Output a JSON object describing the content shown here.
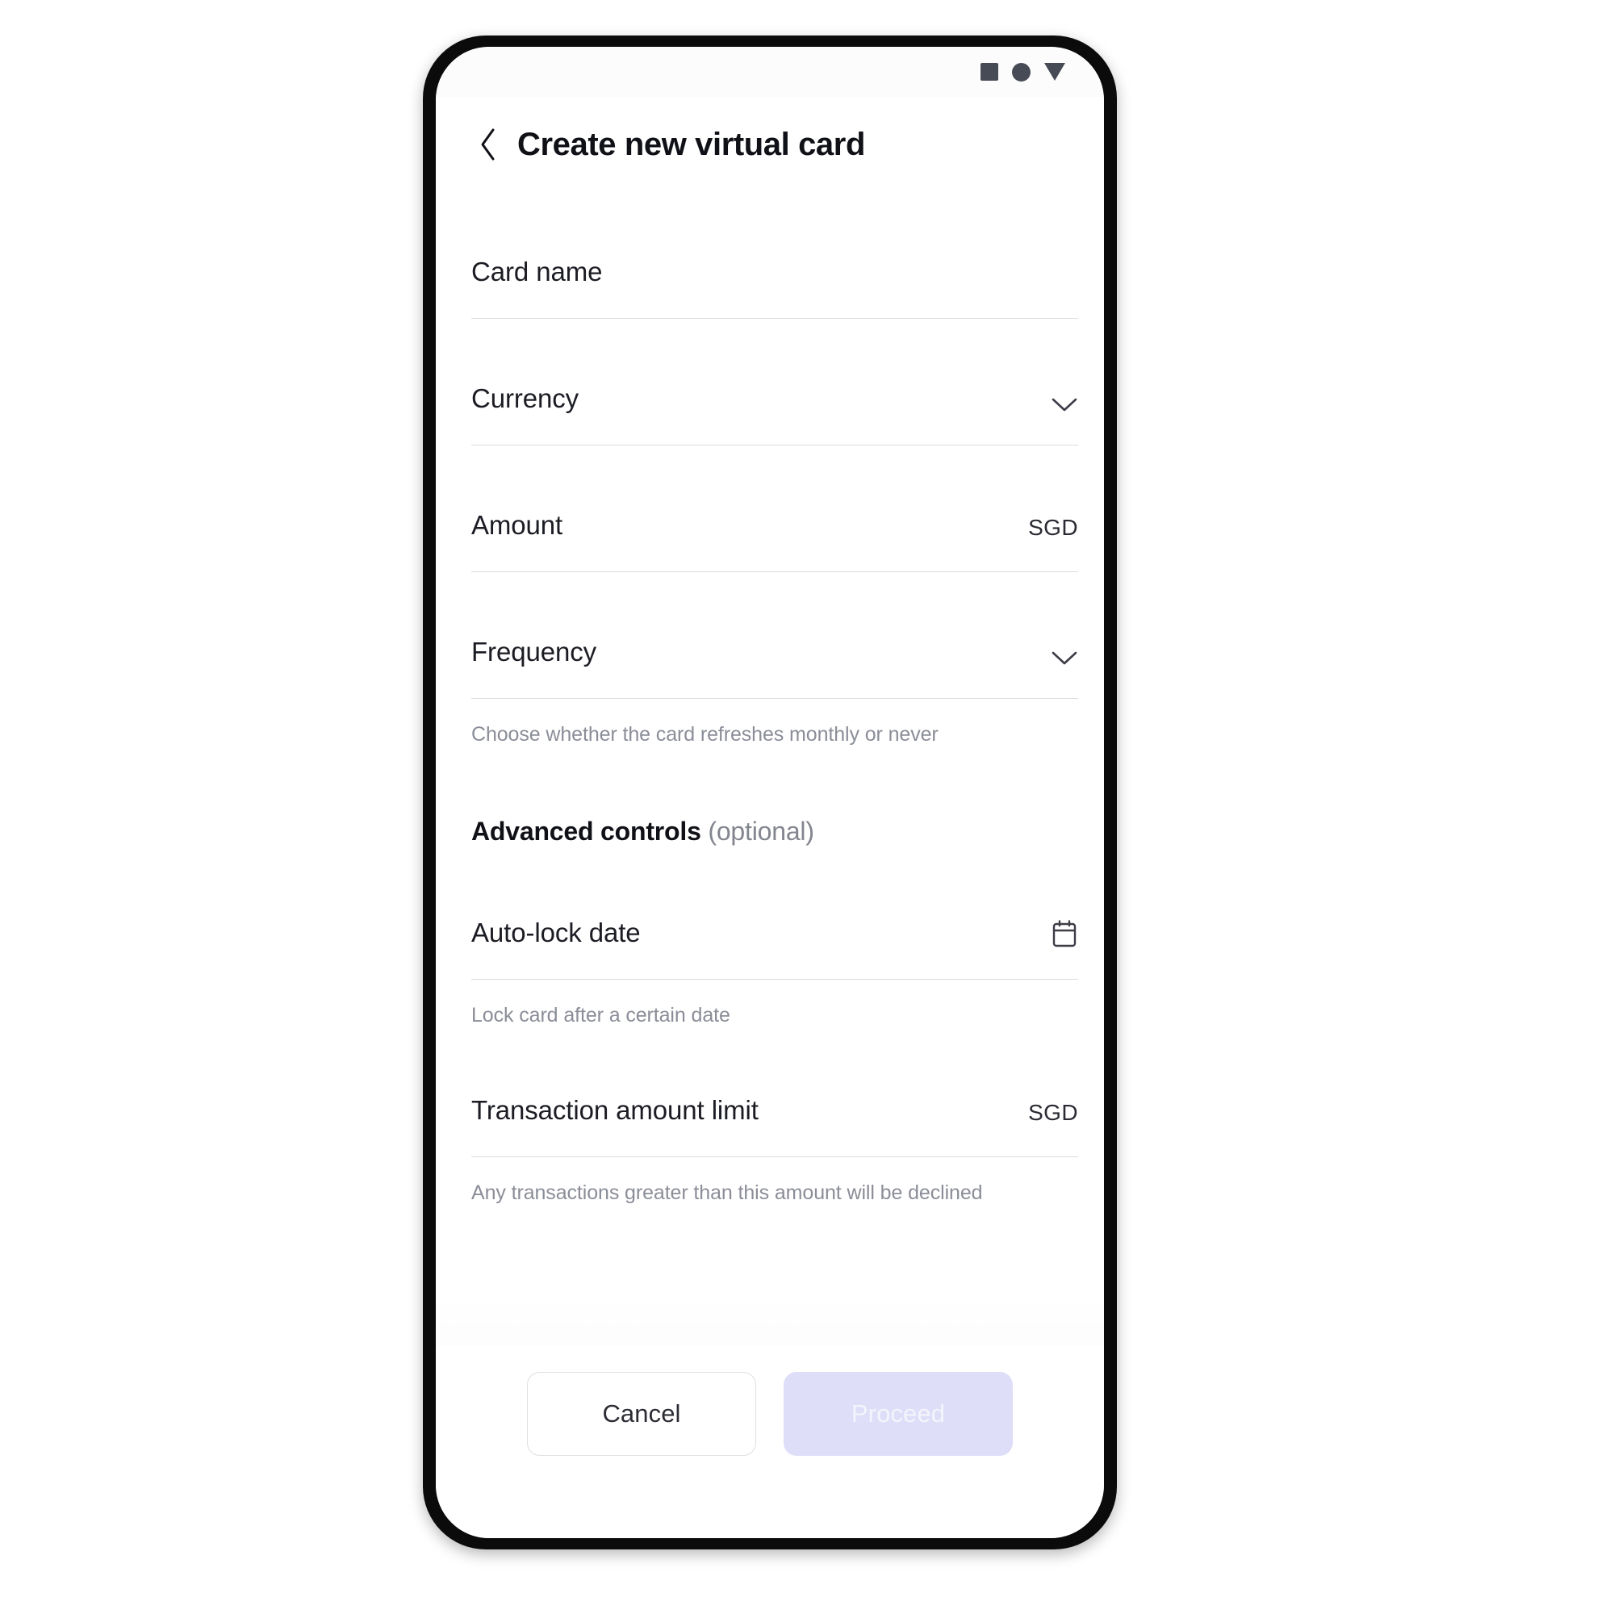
{
  "status_bar": {
    "icons": [
      "square-icon",
      "circle-icon",
      "triangle-down-icon"
    ]
  },
  "header": {
    "back_icon": "chevron-left-icon",
    "title": "Create new virtual card"
  },
  "form": {
    "fields": [
      {
        "label": "Card name",
        "value": "",
        "placeholder": "",
        "suffix": "",
        "trailing_icon": "",
        "help": ""
      },
      {
        "label": "Currency",
        "value": "",
        "placeholder": "",
        "suffix": "",
        "trailing_icon": "chevron-down-icon",
        "help": ""
      },
      {
        "label": "Amount",
        "value": "",
        "placeholder": "",
        "suffix": "SGD",
        "trailing_icon": "",
        "help": ""
      },
      {
        "label": "Frequency",
        "value": "",
        "placeholder": "",
        "suffix": "",
        "trailing_icon": "chevron-down-icon",
        "help": "Choose whether the card refreshes monthly or never"
      }
    ],
    "advanced_section": {
      "title": "Advanced controls",
      "optional_note": "(optional)",
      "fields": [
        {
          "label": "Auto-lock date",
          "value": "",
          "placeholder": "",
          "suffix": "",
          "trailing_icon": "calendar-icon",
          "help": "Lock card after a certain date"
        },
        {
          "label": "Transaction amount limit",
          "value": "",
          "placeholder": "",
          "suffix": "SGD",
          "trailing_icon": "",
          "help": "Any transactions greater than this amount will be declined"
        }
      ]
    }
  },
  "footer": {
    "cancel_label": "Cancel",
    "proceed_label": "Proceed",
    "proceed_enabled": false
  },
  "colors": {
    "accent_disabled": "#dfdef8",
    "text_primary": "#101117",
    "text_muted": "#8b8d98",
    "divider": "#dcdce2",
    "bezel": "#0b0b0c"
  }
}
